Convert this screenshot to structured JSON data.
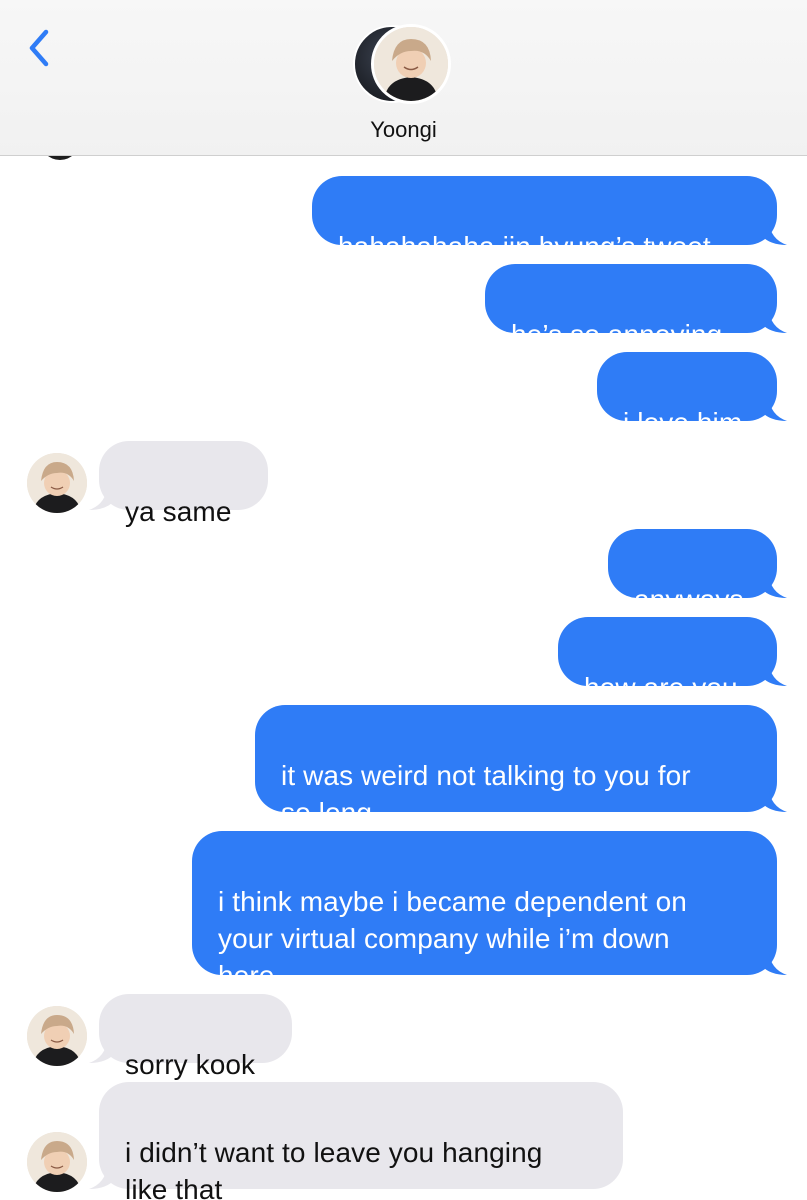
{
  "header": {
    "contact_name": "Yoongi",
    "back_icon": "chevron-left-icon",
    "accent_color": "#2f7cf6"
  },
  "colors": {
    "sent_bubble": "#2f7cf6",
    "received_bubble": "#e8e7ec",
    "header_bg": "#f5f5f5"
  },
  "messages": [
    {
      "from": "me",
      "text": "hahahahaha jin hyung’s tweet"
    },
    {
      "from": "me",
      "text": "he’s so annoying"
    },
    {
      "from": "me",
      "text": "i love him"
    },
    {
      "from": "contact",
      "text": "ya same"
    },
    {
      "from": "me",
      "text": "anyways"
    },
    {
      "from": "me",
      "text": "how are you"
    },
    {
      "from": "me",
      "text": "it was weird not talking to you for\nso long"
    },
    {
      "from": "me",
      "text": "i think maybe i became dependent on\nyour virtual company while i’m down\nhere"
    },
    {
      "from": "contact",
      "text": "sorry kook"
    },
    {
      "from": "contact",
      "text": "i didn’t want to leave you hanging\nlike that"
    }
  ]
}
